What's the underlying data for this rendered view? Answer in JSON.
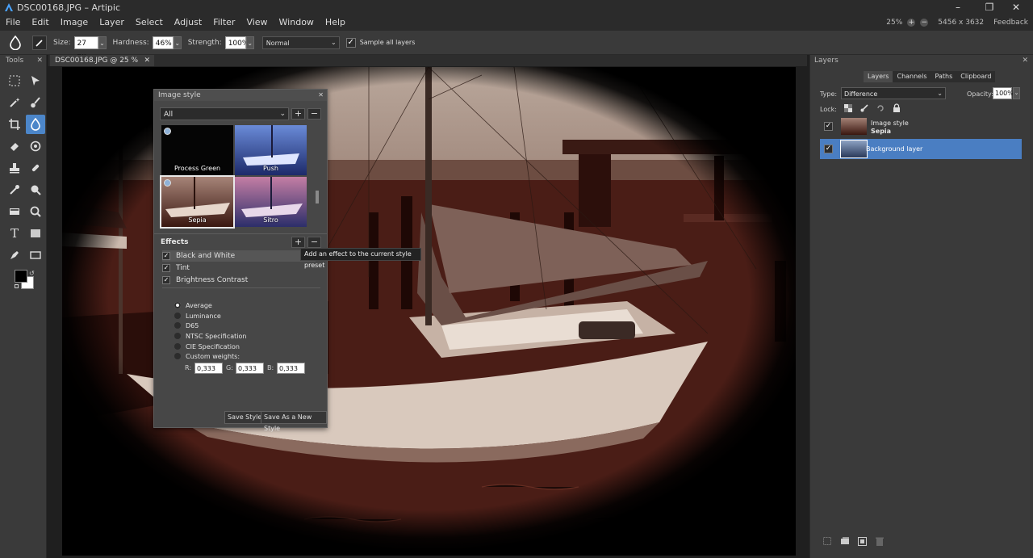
{
  "window": {
    "title": "DSC00168.JPG – Artipic",
    "controls": [
      "minimize",
      "maximize",
      "close"
    ]
  },
  "menu": {
    "items": [
      "File",
      "Edit",
      "Image",
      "Layer",
      "Select",
      "Adjust",
      "Filter",
      "View",
      "Window",
      "Help"
    ],
    "zoom": "25%",
    "dimensions": "5456 x 3632",
    "feedback": "Feedback"
  },
  "context_bar": {
    "size_label": "Size:",
    "size_value": "27 px",
    "hardness_label": "Hardness:",
    "hardness_value": "46%",
    "strength_label": "Strength:",
    "strength_value": "100%",
    "blend_mode": "Normal",
    "sample_all_label": "Sample all layers",
    "sample_all_checked": true
  },
  "tools_panel": {
    "title": "Tools",
    "active_tool": "blur-tool",
    "tools": [
      "marquee-select",
      "move",
      "magic-wand",
      "brush",
      "crop",
      "blur",
      "eraser",
      "fill-adjust",
      "clone-stamp",
      "healing",
      "eyedropper",
      "zoom-lens",
      "gradient",
      "zoom",
      "text",
      "shape-fill",
      "pen",
      "rectangle"
    ],
    "foreground_color": "#000000",
    "background_color": "#ffffff"
  },
  "document": {
    "tab_label": "DSC00168.JPG @ 25 %"
  },
  "style_panel": {
    "title": "Image style",
    "category": "All",
    "presets": [
      "Process Green",
      "Push",
      "Sepia",
      "Sitro"
    ],
    "selected_preset": "Sepia",
    "effects_title": "Effects",
    "effects": [
      "Black and White",
      "Tint",
      "Brightness Contrast"
    ],
    "tooltip": "Add an effect to the current style preset",
    "weighting_options": [
      "Average",
      "Luminance",
      "D65",
      "NTSC Specification",
      "CIE Specification",
      "Custom weights:"
    ],
    "selected_weighting": "Average",
    "weights": {
      "r_label": "R:",
      "r": "0,333",
      "g_label": "G:",
      "g": "0,333",
      "b_label": "B:",
      "b": "0,333"
    },
    "save_style": "Save Style",
    "save_as_new": "Save As a New Style"
  },
  "layers_panel": {
    "title": "Layers",
    "tabs": [
      "Layers",
      "Channels",
      "Paths",
      "Clipboard"
    ],
    "active_tab": "Layers",
    "type_label": "Type:",
    "type_value": "Difference",
    "opacity_label": "Opacity:",
    "opacity_value": "100%",
    "lock_label": "Lock:",
    "layers": [
      {
        "name": "Image style",
        "subname": "Sepia",
        "visible": true,
        "selected": false
      },
      {
        "name": "Background layer",
        "subname": "",
        "visible": true,
        "selected": true
      }
    ]
  },
  "colors": {
    "accent": "#4a7ec2",
    "panel": "#3a3a3a",
    "sepia": "#6b3a2a"
  }
}
